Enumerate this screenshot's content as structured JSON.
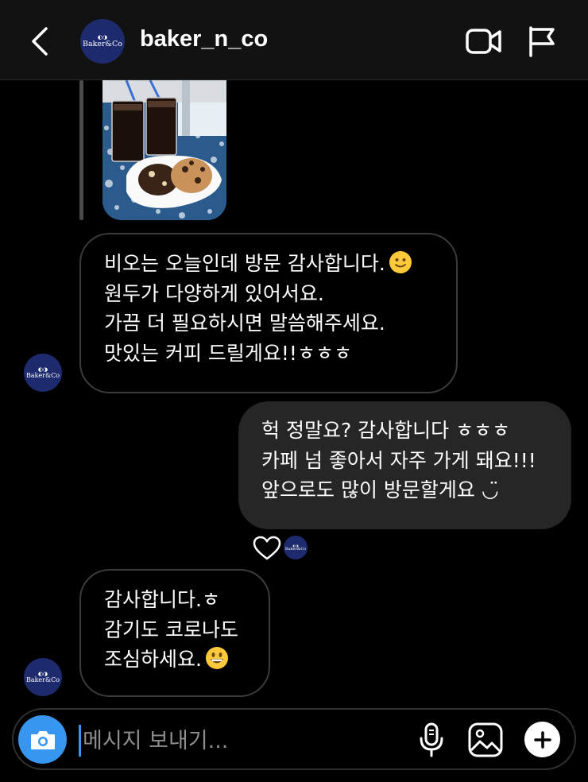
{
  "header": {
    "back_label": "back",
    "avatar_text": "Baker&Co",
    "username": "baker_n_co"
  },
  "shared_post": {
    "description": "photo"
  },
  "messages": [
    {
      "sender": "them",
      "lines": [
        "비오는 오늘인데 방문 감사합니다.",
        "원두가 다양하게 있어서요.",
        "가끔 더 필요하시면 말씀해주세요.",
        "맛있는 커피 드릴게요!!ㅎㅎㅎ"
      ],
      "emoji": "slightly-smiling-face-emoji"
    },
    {
      "sender": "me",
      "lines": [
        "헉 정말요? 감사합니다 ㅎㅎㅎ",
        "카페 넘 좋아서 자주 가게 돼요!!!",
        "앞으로도 많이 방문할게요 ◡̈"
      ],
      "reaction": "heart-icon"
    },
    {
      "sender": "them",
      "lines": [
        "감사합니다.ㅎ",
        "감기도 코로나도",
        "조심하세요."
      ],
      "emoji": "grinning-face-emoji"
    }
  ],
  "composer": {
    "placeholder": "메시지 보내기..."
  },
  "colors": {
    "accent": "#3797f0",
    "sent_bubble": "#262626",
    "avatar_bg": "#1d2a6e"
  }
}
